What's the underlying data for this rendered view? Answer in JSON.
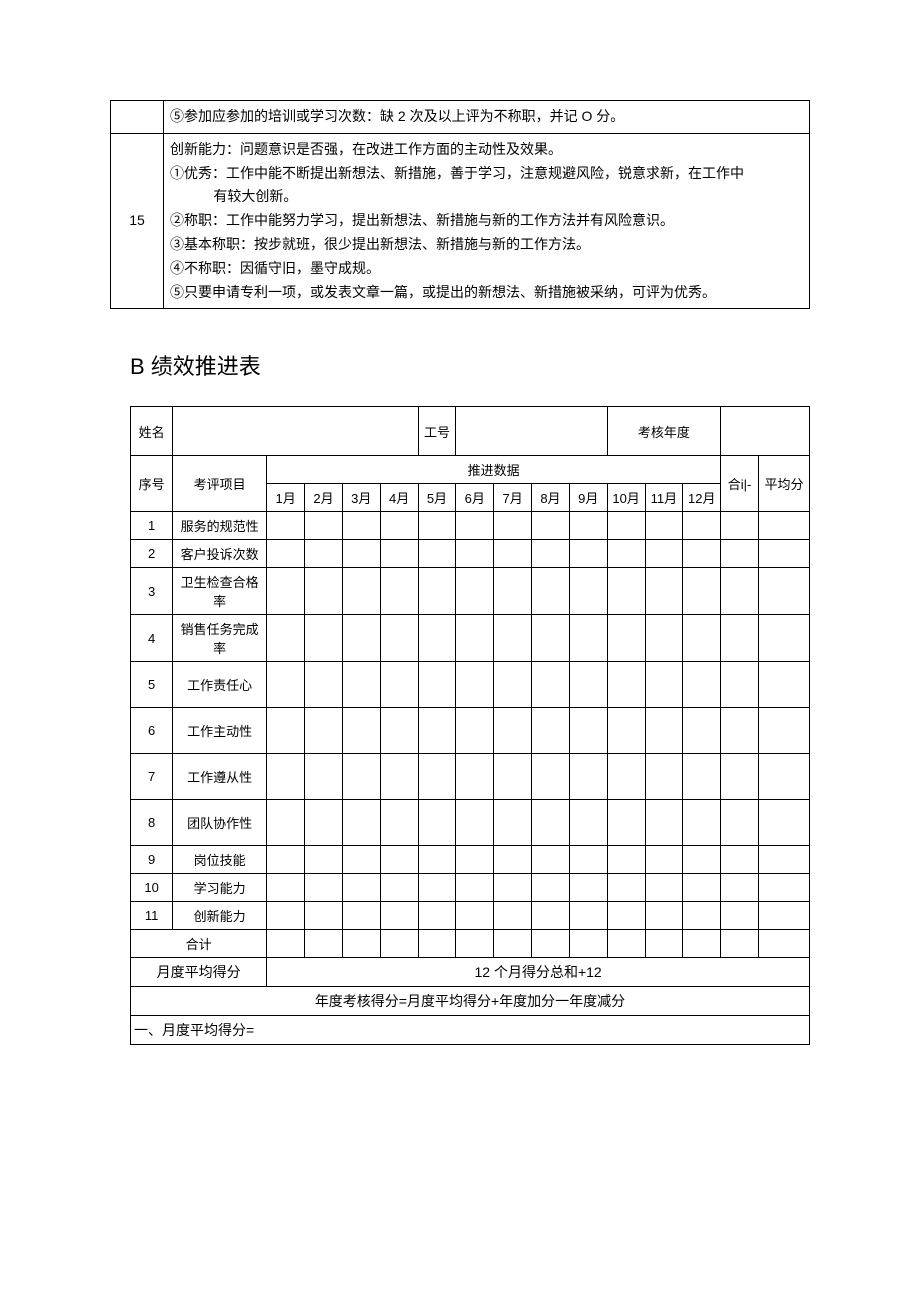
{
  "table1": {
    "row1": {
      "content": "⑤参加应参加的培训或学习次数：缺 2 次及以上评为不称职，并记 O 分。"
    },
    "row2": {
      "num": "15",
      "line1": "创新能力：问题意识是否强，在改进工作方面的主动性及效果。",
      "line2a": "①优秀：工作中能不断提出新想法、新措施，善于学习，注意规避风险，锐意求新，在工作中",
      "line2b": "有较大创新。",
      "line3": "②称职：工作中能努力学习，提出新想法、新措施与新的工作方法并有风险意识。",
      "line4": "③基本称职：按步就班，很少提出新想法、新措施与新的工作方法。",
      "line5": "④不称职：因循守旧，墨守成规。",
      "line6": "⑤只要申请专利一项，或发表文章一篇，或提出的新想法、新措施被采纳，可评为优秀。"
    }
  },
  "section_title": "B 绩效推进表",
  "table2": {
    "header": {
      "name_label": "姓名",
      "id_label": "工号",
      "year_label": "考核年度"
    },
    "sub_header": {
      "seq": "序号",
      "item": "考评项目",
      "data_label": "推进数据",
      "total": "合i|-",
      "avg": "平均分",
      "months": [
        "1月",
        "2月",
        "3月",
        "4月",
        "5月",
        "6月",
        "7月",
        "8月",
        "9月",
        "10月",
        "11月",
        "12月"
      ]
    },
    "rows": [
      {
        "seq": "1",
        "item": "服务的规范性"
      },
      {
        "seq": "2",
        "item": "客户投诉次数"
      },
      {
        "seq": "3",
        "item": "卫生检查合格率"
      },
      {
        "seq": "4",
        "item": "销售任务完成率"
      },
      {
        "seq": "5",
        "item": "工作责任心"
      },
      {
        "seq": "6",
        "item": "工作主动性"
      },
      {
        "seq": "7",
        "item": "工作遵从性"
      },
      {
        "seq": "8",
        "item": "团队协作性"
      },
      {
        "seq": "9",
        "item": "岗位技能"
      },
      {
        "seq": "10",
        "item": "学习能力"
      },
      {
        "seq": "11",
        "item": "创新能力"
      }
    ],
    "total_label": "合计",
    "month_avg_label": "月度平均得分",
    "month_avg_formula": "12 个月得分总和+12",
    "year_formula": "年度考核得分=月度平均得分+年度加分一年度减分",
    "bottom_line": "一、月度平均得分="
  }
}
